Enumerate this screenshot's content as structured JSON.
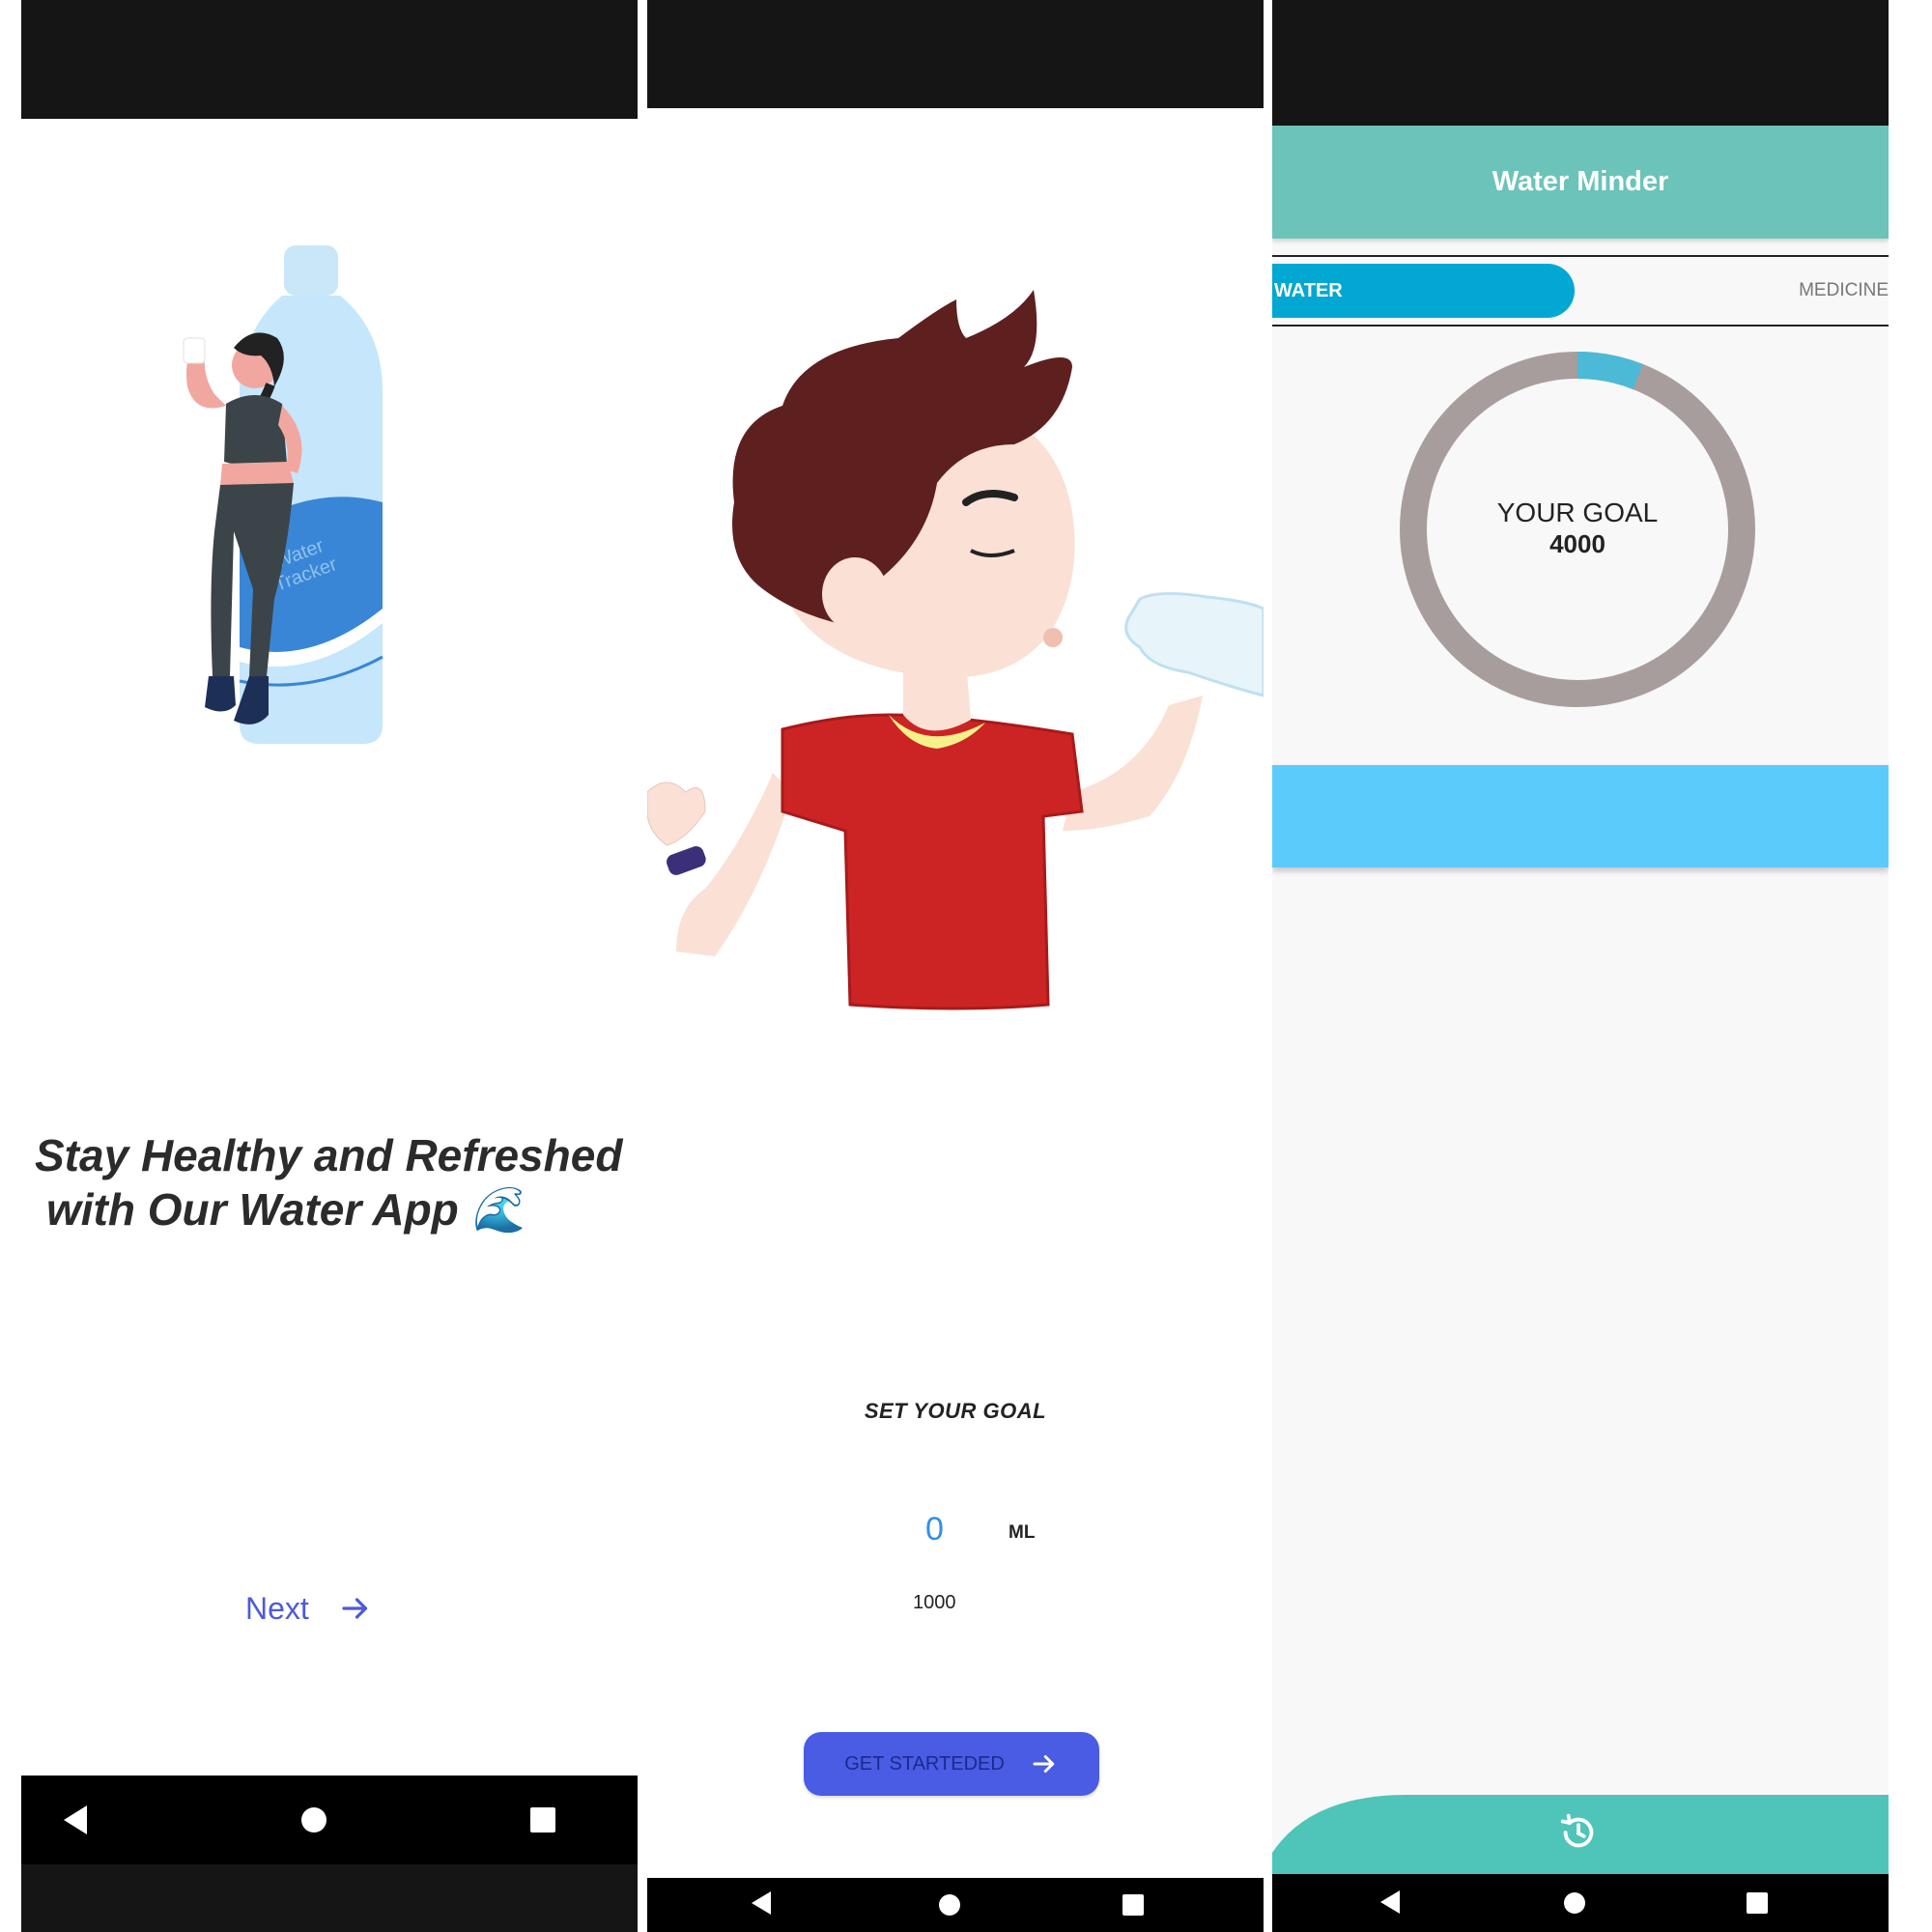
{
  "onboarding_1": {
    "headline_line1": "Stay Healthy and Refreshed",
    "headline_line2": "with Our Water App 🌊",
    "next_label": "Next",
    "illustration": "woman-drinking-water-bottle-illustration",
    "bottle_text": "Water Tracker",
    "icons": {
      "next": "arrow-right-icon"
    }
  },
  "onboarding_2": {
    "illustration": "boy-drinking-water-illustration",
    "goal_label": "SET YOUR GOAL",
    "goal_value": "0",
    "goal_unit": "ML",
    "goal_next_option": "1000",
    "start_label": "GET STARTEDED",
    "icons": {
      "start": "arrow-right-icon"
    }
  },
  "home": {
    "app_title": "Water Minder",
    "tabs": [
      {
        "label": "WATER",
        "selected": true
      },
      {
        "label": "MEDICINE",
        "selected": false
      }
    ],
    "goal_label": "YOUR GOAL",
    "goal_value": "4000",
    "progress_fraction": 0.06,
    "icons": {
      "history": "history-icon"
    }
  },
  "system_nav": {
    "icons": [
      "back-icon",
      "home-icon",
      "recents-icon"
    ]
  },
  "colors": {
    "accent_indigo": "#4a5ce3",
    "next_text": "#4c5bd8",
    "appbar_teal": "#6cc3b9",
    "bottom_teal": "#4fc4b9",
    "tab_blue": "#03a8d2",
    "band_blue": "#5bcbfb",
    "ring_gray": "#a89d9d",
    "ring_progress": "#4cb9d6",
    "status_bar": "#151515"
  }
}
